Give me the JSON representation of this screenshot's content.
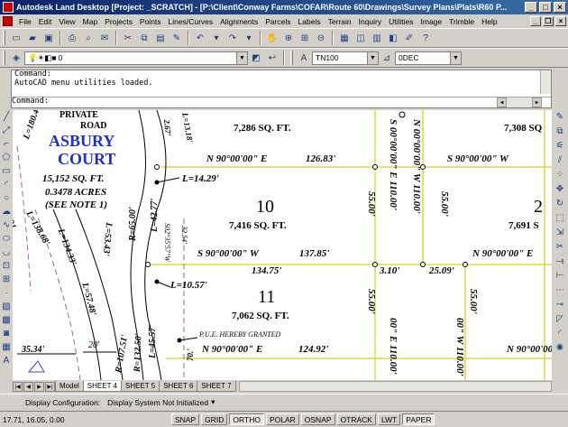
{
  "window": {
    "title": "Autodesk Land Desktop [Project: _SCRATCH] - [P:\\Client\\Conway Farms\\COFAR\\Route 60\\Drawings\\Survey Plans\\Plats\\R60 P..."
  },
  "menu": [
    "File",
    "Edit",
    "View",
    "Map",
    "Projects",
    "Points",
    "Lines/Curves",
    "Alignments",
    "Parcels",
    "Labels",
    "Terrain",
    "Inquiry",
    "Utilities",
    "Image",
    "Trimble",
    "Help"
  ],
  "toolbar2": {
    "layer_value": "0",
    "textstyle_value": "TN100",
    "dimstyle_value": "0DEC"
  },
  "command": {
    "lines": [
      "Command:",
      "AutoCAD menu utilities loaded."
    ],
    "prompt": "Command:"
  },
  "drawing": {
    "road_label_1": "PRIVATE",
    "road_label_2": "ROAD",
    "court_1": "ASBURY",
    "court_2": "COURT",
    "lot9_area": "15,152 SQ. FT.",
    "lot9_acres": "0.3478 ACRES",
    "lot9_note": "(SEE NOTE 1)",
    "top_area": "7,286 SQ. FT.",
    "top_right_area": "7,308 SQ",
    "bearing_top": "N 90°00'00\" E",
    "dist_top": "126.83'",
    "bearing_top_right": "S 90°00'00\" W",
    "l_1429": "L=14.29'",
    "lot10_num": "10",
    "lot10_area": "7,416 SQ. FT.",
    "lot2_num": "2",
    "lot2_area": "7,691 S",
    "bearing_mid": "S 90°00'00\" W",
    "dist_mid": "137.85'",
    "dist_13475": "134.75'",
    "dist_310": "3.10'",
    "dist_2509": "25.09'",
    "bearing_mid_right": "N 90°00'00\" E",
    "l_1057": "L=10.57'",
    "lot11_num": "11",
    "lot11_area": "7,062 SQ. FT.",
    "pue": "P.U.E. HEREBY GRANTED",
    "bearing_bot": "N 90°00'00\" E",
    "dist_bot": "124.92'",
    "bearing_bot_right": "N 90°00'00",
    "dist_3534": "35.34'",
    "dist_20": "20'",
    "v_5500a": "55.00'",
    "v_s00e": "S 00°00'00\" E  110.00'",
    "v_n00w": "N 00°00'00\" W  110.00'",
    "v_5500b": "55.00'",
    "v_5500c": "55.00'",
    "v_5500d": "55.00'",
    "v_00e": "00\" E  110.00'",
    "v_00w": "00\" W  110.00'",
    "curve_l180": "L=180.4",
    "curve_l1386": "L=138.68'",
    "curve_l13433": "L=134.33'",
    "curve_l5748": "L=57.48'",
    "curve_l5343": "L=53.43'",
    "curve_r6500": "R=65.00'",
    "curve_l4277": "L=42.77'",
    "curve_l4557": "L=45.57'",
    "curve_r13250": "R=132.50'",
    "curve_r10751": "R=107.51'",
    "curve_l1318": "L=13.18'",
    "curve_267": "2.67'",
    "curve_s02": "S02°35'57\"W",
    "curve_3254": "32.54'",
    "curve_70": "70.'",
    "curve_91": "91"
  },
  "layout_tabs": [
    "Model",
    "SHEET 4",
    "SHEET 5",
    "SHEET 6",
    "SHEET 7"
  ],
  "display_config": {
    "label": "Display Configuration:",
    "value": "Display System Not Initialized",
    "arrow": "▾"
  },
  "status": {
    "coords": "17.71, 16.05, 0.00",
    "buttons": [
      "SNAP",
      "GRID",
      "ORTHO",
      "POLAR",
      "OSNAP",
      "OTRACK",
      "LWT",
      "PAPER"
    ],
    "on": [
      "ORTHO",
      "PAPER"
    ]
  },
  "colors": {
    "title_bar": "#0a246a",
    "court_label": "#1f2fd0",
    "lot_lines": "#e0d640",
    "easement": "#a060a0"
  }
}
